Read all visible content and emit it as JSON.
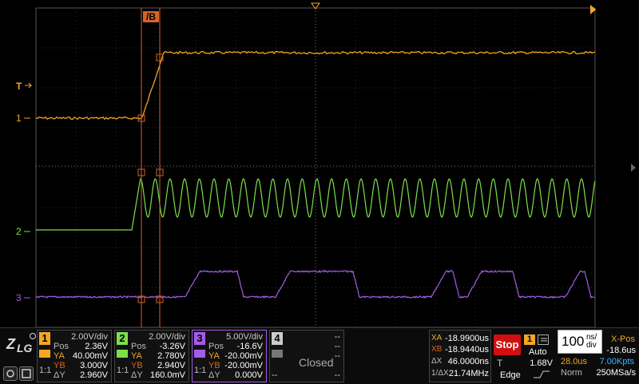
{
  "markers": {
    "cursor_b_label": "/B",
    "trigger_label": "T",
    "ch1_label": "1",
    "ch2_label": "2",
    "ch3_label": "3"
  },
  "channels": [
    {
      "num": "1",
      "color": "#f5a623",
      "scale": "2.00V/div",
      "pos_label": "Pos",
      "pos": "2.36V",
      "ya_label": "YA",
      "ya": "40.00mV",
      "yb_label": "YB",
      "yb": "3.000V",
      "dy_label": "ΔY",
      "dy": "2.960V",
      "ratio": "1:1"
    },
    {
      "num": "2",
      "color": "#7be04a",
      "scale": "2.00V/div",
      "pos_label": "Pos",
      "pos": "-3.26V",
      "ya_label": "YA",
      "ya": "2.780V",
      "yb_label": "YB",
      "yb": "2.940V",
      "dy_label": "ΔY",
      "dy": "160.0mV",
      "ratio": "1:1"
    },
    {
      "num": "3",
      "color": "#a45ce8",
      "scale": "5.00V/div",
      "pos_label": "Pos",
      "pos": "-16.6V",
      "ya_label": "YA",
      "ya": "-20.00mV",
      "yb_label": "YB",
      "yb": "-20.00mV",
      "dy_label": "ΔY",
      "dy": "0.000V",
      "ratio": "1:1"
    },
    {
      "num": "4",
      "scale": "--",
      "state": "Closed",
      "dash1": "--",
      "dash2": "--",
      "dash3": "--",
      "dash4": "--"
    }
  ],
  "cursors": {
    "xa_label": "XA",
    "xa": "-18.9900us",
    "xb_label": "XB",
    "xb": "-18.9440us",
    "dx_label": "ΔX",
    "dx": "46.0000ns",
    "freq_label": "1/ΔX",
    "freq": "21.74MHz"
  },
  "trigger": {
    "run_state": "Stop",
    "source": "1",
    "mode": "Auto",
    "t_label": "T",
    "level": "1.68V",
    "type": "Edge"
  },
  "timebase": {
    "value": "100",
    "unit_top": "ns/",
    "unit_bottom": "div",
    "xpos_label": "X-Pos",
    "xpos": "-18.6us",
    "holdoff": "28.0us",
    "points": "7.00Kpts",
    "acq": "Norm",
    "rate": "250MSa/s"
  },
  "colors": {
    "ch1": "#f5a623",
    "ch2": "#7be04a",
    "ch3": "#a45ce8",
    "cursor": "#d2642a",
    "grid": "#3a3a3a"
  },
  "icons": [
    "zlg-logo",
    "capture-icon",
    "save-icon",
    "trigger-edge-icon",
    "menu-icon"
  ]
}
